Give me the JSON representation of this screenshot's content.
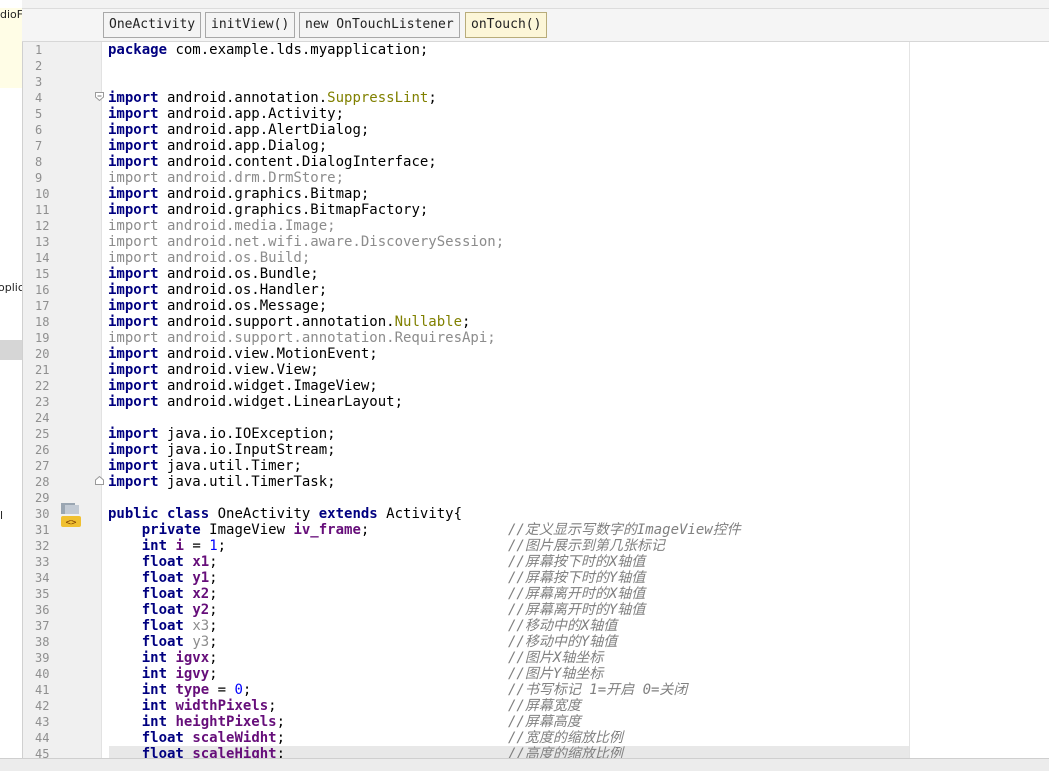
{
  "left_panel": {
    "fragments": [
      "dioF",
      "oplic",
      "l"
    ]
  },
  "breadcrumbs": [
    {
      "label": "OneActivity",
      "active": false
    },
    {
      "label": "initView()",
      "active": false
    },
    {
      "label": "new OnTouchListener",
      "active": false
    },
    {
      "label": "onTouch()",
      "active": true
    }
  ],
  "gutter": {
    "icon": "override-method-icon"
  },
  "colors": {
    "keyword": "#000080",
    "annotation": "#808000",
    "field": "#660e7a",
    "number": "#0000ff",
    "unused": "#8c8c8c",
    "comment": "#808080",
    "active_crumb": "#fcf6d8"
  },
  "code_lines": [
    [
      [
        "kw",
        "package"
      ],
      [
        "t",
        " com.example.lds.myapplication;"
      ]
    ],
    [],
    [],
    [
      [
        "kw",
        "import"
      ],
      [
        "t",
        " android.annotation."
      ],
      [
        "ann",
        "SuppressLint"
      ],
      [
        "t",
        ";"
      ]
    ],
    [
      [
        "kw",
        "import"
      ],
      [
        "t",
        " android.app.Activity;"
      ]
    ],
    [
      [
        "kw",
        "import"
      ],
      [
        "t",
        " android.app.AlertDialog;"
      ]
    ],
    [
      [
        "kw",
        "import"
      ],
      [
        "t",
        " android.app.Dialog;"
      ]
    ],
    [
      [
        "kw",
        "import"
      ],
      [
        "t",
        " android.content.DialogInterface;"
      ]
    ],
    [
      [
        "un",
        "import android.drm.DrmStore;"
      ]
    ],
    [
      [
        "kw",
        "import"
      ],
      [
        "t",
        " android.graphics.Bitmap;"
      ]
    ],
    [
      [
        "kw",
        "import"
      ],
      [
        "t",
        " android.graphics.BitmapFactory;"
      ]
    ],
    [
      [
        "un",
        "import android.media.Image;"
      ]
    ],
    [
      [
        "un",
        "import android.net.wifi.aware.DiscoverySession;"
      ]
    ],
    [
      [
        "un",
        "import android.os.Build;"
      ]
    ],
    [
      [
        "kw",
        "import"
      ],
      [
        "t",
        " android.os.Bundle;"
      ]
    ],
    [
      [
        "kw",
        "import"
      ],
      [
        "t",
        " android.os.Handler;"
      ]
    ],
    [
      [
        "kw",
        "import"
      ],
      [
        "t",
        " android.os.Message;"
      ]
    ],
    [
      [
        "kw",
        "import"
      ],
      [
        "t",
        " android.support.annotation."
      ],
      [
        "ann",
        "Nullable"
      ],
      [
        "t",
        ";"
      ]
    ],
    [
      [
        "un",
        "import android.support.annotation.RequiresApi;"
      ]
    ],
    [
      [
        "kw",
        "import"
      ],
      [
        "t",
        " android.view.MotionEvent;"
      ]
    ],
    [
      [
        "kw",
        "import"
      ],
      [
        "t",
        " android.view.View;"
      ]
    ],
    [
      [
        "kw",
        "import"
      ],
      [
        "t",
        " android.widget.ImageView;"
      ]
    ],
    [
      [
        "kw",
        "import"
      ],
      [
        "t",
        " android.widget.LinearLayout;"
      ]
    ],
    [],
    [
      [
        "kw",
        "import"
      ],
      [
        "t",
        " java.io.IOException;"
      ]
    ],
    [
      [
        "kw",
        "import"
      ],
      [
        "t",
        " java.io.InputStream;"
      ]
    ],
    [
      [
        "kw",
        "import"
      ],
      [
        "t",
        " java.util.Timer;"
      ]
    ],
    [
      [
        "kw",
        "import"
      ],
      [
        "t",
        " java.util.TimerTask;"
      ]
    ],
    [],
    [
      [
        "kw",
        "public class"
      ],
      [
        "t",
        " OneActivity "
      ],
      [
        "kw",
        "extends"
      ],
      [
        "t",
        " Activity{"
      ]
    ],
    [
      [
        "t",
        "    "
      ],
      [
        "kw",
        "private"
      ],
      [
        "t",
        " ImageView "
      ],
      [
        "fd",
        "iv_frame"
      ],
      [
        "t",
        ";"
      ]
    ],
    [
      [
        "t",
        "    "
      ],
      [
        "kw",
        "int"
      ],
      [
        "t",
        " "
      ],
      [
        "fd",
        "i"
      ],
      [
        "t",
        " = "
      ],
      [
        "num",
        "1"
      ],
      [
        "t",
        ";"
      ]
    ],
    [
      [
        "t",
        "    "
      ],
      [
        "kw",
        "float"
      ],
      [
        "t",
        " "
      ],
      [
        "fd",
        "x1"
      ],
      [
        "t",
        ";"
      ]
    ],
    [
      [
        "t",
        "    "
      ],
      [
        "kw",
        "float"
      ],
      [
        "t",
        " "
      ],
      [
        "fd",
        "y1"
      ],
      [
        "t",
        ";"
      ]
    ],
    [
      [
        "t",
        "    "
      ],
      [
        "kw",
        "float"
      ],
      [
        "t",
        " "
      ],
      [
        "fd",
        "x2"
      ],
      [
        "t",
        ";"
      ]
    ],
    [
      [
        "t",
        "    "
      ],
      [
        "kw",
        "float"
      ],
      [
        "t",
        " "
      ],
      [
        "fd",
        "y2"
      ],
      [
        "t",
        ";"
      ]
    ],
    [
      [
        "t",
        "    "
      ],
      [
        "kw",
        "float"
      ],
      [
        "t",
        " "
      ],
      [
        "un",
        "x3"
      ],
      [
        "t",
        ";"
      ]
    ],
    [
      [
        "t",
        "    "
      ],
      [
        "kw",
        "float"
      ],
      [
        "t",
        " "
      ],
      [
        "un",
        "y3"
      ],
      [
        "t",
        ";"
      ]
    ],
    [
      [
        "t",
        "    "
      ],
      [
        "kw",
        "int"
      ],
      [
        "t",
        " "
      ],
      [
        "fd",
        "igvx"
      ],
      [
        "t",
        ";"
      ]
    ],
    [
      [
        "t",
        "    "
      ],
      [
        "kw",
        "int"
      ],
      [
        "t",
        " "
      ],
      [
        "fd",
        "igvy"
      ],
      [
        "t",
        ";"
      ]
    ],
    [
      [
        "t",
        "    "
      ],
      [
        "kw",
        "int"
      ],
      [
        "t",
        " "
      ],
      [
        "fd",
        "type"
      ],
      [
        "t",
        " = "
      ],
      [
        "num",
        "0"
      ],
      [
        "t",
        ";"
      ]
    ],
    [
      [
        "t",
        "    "
      ],
      [
        "kw",
        "int"
      ],
      [
        "t",
        " "
      ],
      [
        "fd",
        "widthPixels"
      ],
      [
        "t",
        ";"
      ]
    ],
    [
      [
        "t",
        "    "
      ],
      [
        "kw",
        "int"
      ],
      [
        "t",
        " "
      ],
      [
        "fd",
        "heightPixels"
      ],
      [
        "t",
        ";"
      ]
    ],
    [
      [
        "t",
        "    "
      ],
      [
        "kw",
        "float"
      ],
      [
        "t",
        " "
      ],
      [
        "fd",
        "scaleWidht"
      ],
      [
        "t",
        ";"
      ]
    ],
    [
      [
        "t",
        "    "
      ],
      [
        "kw",
        "float"
      ],
      [
        "t",
        " "
      ],
      [
        "fd",
        "scaleHight"
      ],
      [
        "t",
        ";"
      ]
    ]
  ],
  "comments": {
    "31": "//定义显示写数字的ImageView控件",
    "32": "//图片展示到第几张标记",
    "33": "//屏幕按下时的X轴值",
    "34": "//屏幕按下时的Y轴值",
    "35": "//屏幕离开时的X轴值",
    "36": "//屏幕离开时的Y轴值",
    "37": "//移动中的X轴值",
    "38": "//移动中的Y轴值",
    "39": "//图片X轴坐标",
    "40": "//图片Y轴坐标",
    "41": "//书写标记 1=开启 0=关闭",
    "42": "//屏幕宽度",
    "43": "//屏幕高度",
    "44": "//宽度的缩放比例",
    "45": "//高度的缩放比例"
  }
}
